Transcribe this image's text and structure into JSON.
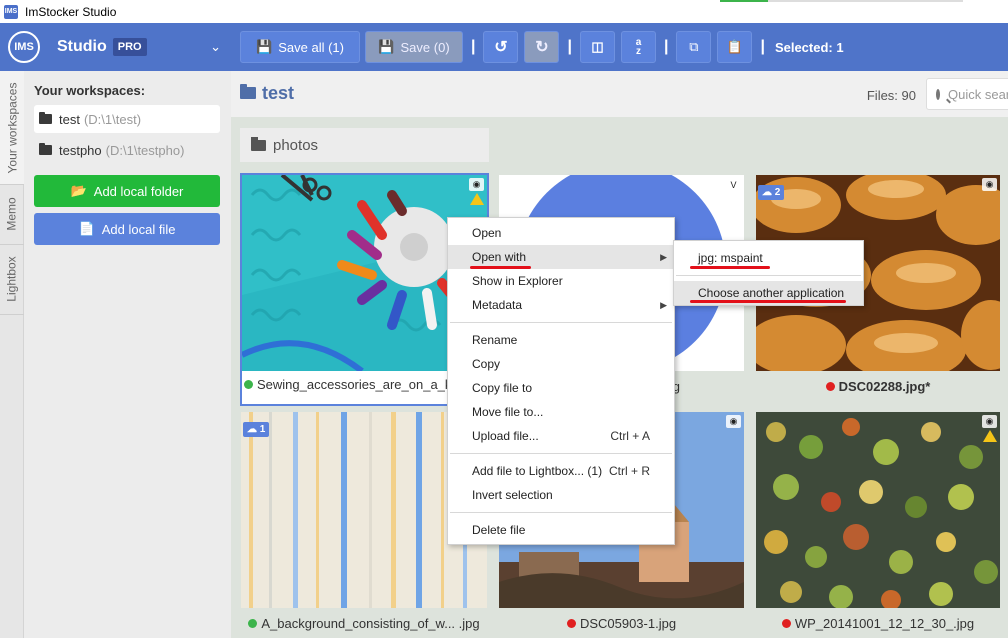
{
  "window": {
    "title": "ImStocker Studio",
    "app_icon": "IMS"
  },
  "brand": {
    "logo": "IMS",
    "name": "Studio",
    "edition": "PRO"
  },
  "toolbar": {
    "save_all_label": "Save all (1)",
    "save_label": "Save (0)",
    "selected_label": "Selected: 1"
  },
  "vertical_tabs": [
    "Your workspaces",
    "Memo",
    "Lightbox"
  ],
  "sidebar": {
    "heading": "Your workspaces:",
    "workspaces": [
      {
        "name": "test",
        "path": "(D:\\1\\test)"
      },
      {
        "name": "testpho",
        "path": "(D:\\1\\testpho)"
      }
    ],
    "add_folder_label": "Add local folder",
    "add_file_label": "Add local file"
  },
  "content": {
    "folder_name": "test",
    "files_count": "Files: 90",
    "search_placeholder": "Quick search",
    "subfolder": "photos"
  },
  "thumbnails": [
    {
      "caption": "Sewing_accessories_are_on_a_k",
      "status": "green"
    },
    {
      "caption": "g",
      "status": "none"
    },
    {
      "caption": "DSC02288.jpg*",
      "status": "red",
      "cloud": "2"
    },
    {
      "caption": "A_background_consisting_of_w... .jpg",
      "status": "green",
      "cloud": "1"
    },
    {
      "caption": "DSC05903-1.jpg",
      "status": "red"
    },
    {
      "caption": "WP_20141001_12_12_30_.jpg",
      "status": "red"
    }
  ],
  "context_menu": {
    "items": [
      {
        "label": "Open"
      },
      {
        "label": "Open with",
        "submenu": true
      },
      {
        "label": "Show in Explorer"
      },
      {
        "label": "Metadata",
        "submenu": true
      },
      {
        "label": "Rename"
      },
      {
        "label": "Copy"
      },
      {
        "label": "Copy file to"
      },
      {
        "label": "Move file to..."
      },
      {
        "label": "Upload file...",
        "shortcut": "Ctrl + A"
      },
      {
        "label": "Add file to Lightbox... (1)",
        "shortcut": "Ctrl + R"
      },
      {
        "label": "Invert selection"
      },
      {
        "label": "Delete file"
      }
    ]
  },
  "open_with_submenu": {
    "items": [
      {
        "label": "jpg: mspaint"
      },
      {
        "label": "Choose another application"
      }
    ]
  },
  "colors": {
    "accent": "#4f74c9",
    "green": "#22b93a",
    "annotation": "#e3101a"
  }
}
